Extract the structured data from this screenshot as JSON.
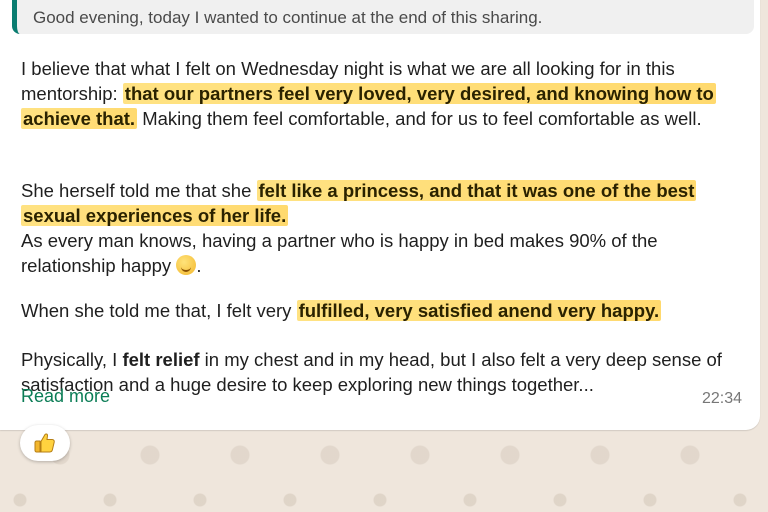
{
  "quote": {
    "text": "Good evening, today I wanted to continue at the end of this sharing."
  },
  "message": {
    "p1": {
      "a": "I believe that what I felt on Wednesday night is what we are all looking for in this mentorship: ",
      "hl": "that our partners feel very loved, very desired, and knowing how to achieve that.",
      "b": " Making them feel comfortable, and for us to feel comfortable as well."
    },
    "p2": {
      "a": "She herself told me that she ",
      "hl": "felt like a princess, and that it was one of the best sexual experiences of her life.",
      "b": "As every man knows, having a partner who is happy in bed makes 90% of the relationship happy ",
      "c": "."
    },
    "p3": {
      "a": "When she told me that, I felt very ",
      "hl": "fulfilled, very satisfied anend very happy."
    },
    "p4": {
      "a": "Physically, I ",
      "bold": "felt relief",
      "b": " in my chest and in my head, but I also felt a very deep sense of satisfaction and a huge desire to keep exploring new things together..."
    },
    "read_more": "Read more",
    "time": "22:34"
  },
  "reaction": {
    "icon": "thumbs-up-icon"
  }
}
